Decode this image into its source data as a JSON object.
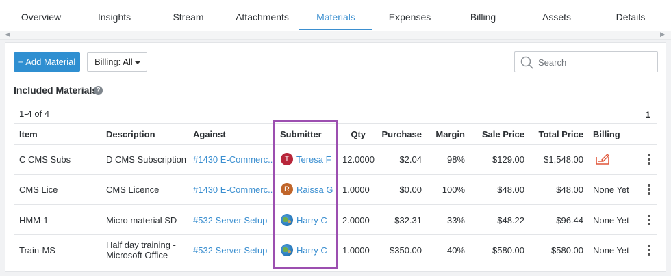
{
  "tabs": [
    {
      "label": "Overview"
    },
    {
      "label": "Insights"
    },
    {
      "label": "Stream"
    },
    {
      "label": "Attachments"
    },
    {
      "label": "Materials",
      "active": true
    },
    {
      "label": "Expenses"
    },
    {
      "label": "Billing"
    },
    {
      "label": "Assets"
    },
    {
      "label": "Details"
    }
  ],
  "toolbar": {
    "add_label": "+ Add Material",
    "billing_label": "Billing:",
    "billing_value": "All",
    "search_placeholder": "Search"
  },
  "section": {
    "title": "Included Materials",
    "help_icon": "question-circle-icon"
  },
  "pagination": {
    "count": "1-4 of 4",
    "page": "1"
  },
  "table": {
    "headers": [
      "Item",
      "Description",
      "Against",
      "Submitter",
      "Qty",
      "Purchase",
      "Margin",
      "Sale Price",
      "Total Price",
      "Billing"
    ],
    "rows": [
      {
        "item": "C CMS Subs",
        "description": "D CMS Subscription",
        "against": "#1430 E-Commerc...",
        "submitter": "Teresa F",
        "avatar": {
          "type": "initial",
          "letter": "T",
          "color": "#b8263a"
        },
        "qty": "12.0000",
        "purchase": "$2.04",
        "margin": "98%",
        "sale": "$129.00",
        "total": "$1,548.00",
        "billing": "",
        "billing_icon": "invoice-edit-icon"
      },
      {
        "item": "CMS Lice",
        "description": "CMS Licence",
        "against": "#1430 E-Commerc...",
        "submitter": "Raissa G",
        "avatar": {
          "type": "initial",
          "letter": "R",
          "color": "#c0652a"
        },
        "qty": "1.0000",
        "purchase": "$0.00",
        "margin": "100%",
        "sale": "$48.00",
        "total": "$48.00",
        "billing": "None Yet"
      },
      {
        "item": "HMM-1",
        "description": "Micro material SD",
        "against": "#532 Server Setup",
        "submitter": "Harry C",
        "avatar": {
          "type": "globe"
        },
        "qty": "2.0000",
        "purchase": "$32.31",
        "margin": "33%",
        "sale": "$48.22",
        "total": "$96.44",
        "billing": "None Yet"
      },
      {
        "item": "Train-MS",
        "description": "Half day training - Microsoft Office",
        "against": "#532 Server Setup",
        "submitter": "Harry C",
        "avatar": {
          "type": "globe"
        },
        "qty": "1.0000",
        "purchase": "$350.00",
        "margin": "40%",
        "sale": "$580.00",
        "total": "$580.00",
        "billing": "None Yet"
      }
    ]
  },
  "colors": {
    "accent": "#3b8fd0",
    "button": "#2f8fd1",
    "highlight": "#9c4fb0",
    "billing_icon": "#e0573a"
  }
}
